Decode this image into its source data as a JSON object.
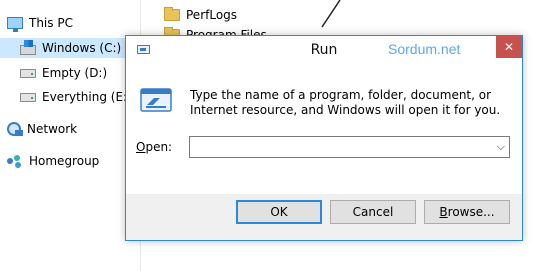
{
  "explorer": {
    "nav": [
      {
        "label": "This PC",
        "icon": "pc-icon"
      },
      {
        "label": "Windows (C:)",
        "icon": "windows-drive-icon"
      },
      {
        "label": "Empty (D:)",
        "icon": "drive-icon"
      },
      {
        "label": "Everything (E:)",
        "icon": "drive-icon"
      },
      {
        "label": "Network",
        "icon": "network-icon"
      },
      {
        "label": "Homegroup",
        "icon": "homegroup-icon"
      }
    ],
    "files": [
      {
        "label": "PerfLogs",
        "icon": "folder-icon"
      },
      {
        "label": "Program Files",
        "icon": "folder-icon"
      }
    ]
  },
  "dialog": {
    "title": "Run",
    "watermark": "Sordum.net",
    "close_glyph": "✕",
    "description": "Type the name of a program, folder, document, or Internet resource, and Windows will open it for you.",
    "open_label_underlined": "O",
    "open_label_rest": "pen:",
    "open_value": "",
    "combo_arrow": "⌵",
    "buttons": {
      "ok": "OK",
      "cancel": "Cancel",
      "browse_underlined": "B",
      "browse_rest": "rowse..."
    }
  },
  "colors": {
    "accent": "#2b8ad8",
    "close": "#c7514d",
    "selected": "#cce8ff",
    "watermark": "#5aa8ea"
  }
}
